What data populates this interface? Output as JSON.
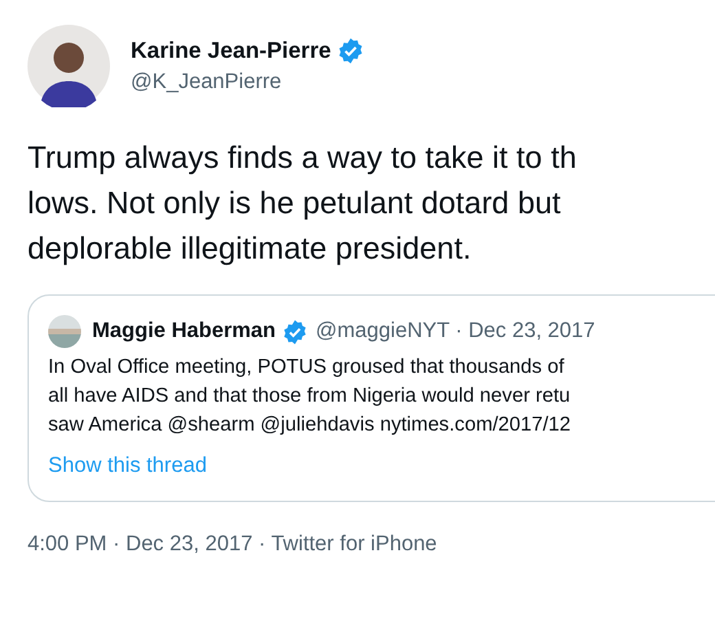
{
  "author": {
    "name": "Karine Jean-Pierre",
    "handle": "@K_JeanPierre",
    "verified": true
  },
  "text": [
    "Trump always finds a way to take it to th",
    "lows. Not only is he petulant dotard but",
    "deplorable illegitimate president."
  ],
  "quoted": {
    "name": "Maggie Haberman",
    "verified": true,
    "handle": "@maggieNYT · Dec 23, 2017",
    "lines": [
      "In Oval Office meeting, POTUS groused that thousands of",
      "all have AIDS and that those from Nigeria would never retu",
      "saw America @shearm @juliehdavis nytimes.com/2017/12"
    ],
    "thread_link": "Show this thread"
  },
  "meta": "4:00 PM · Dec 23, 2017 · Twitter for iPhone"
}
